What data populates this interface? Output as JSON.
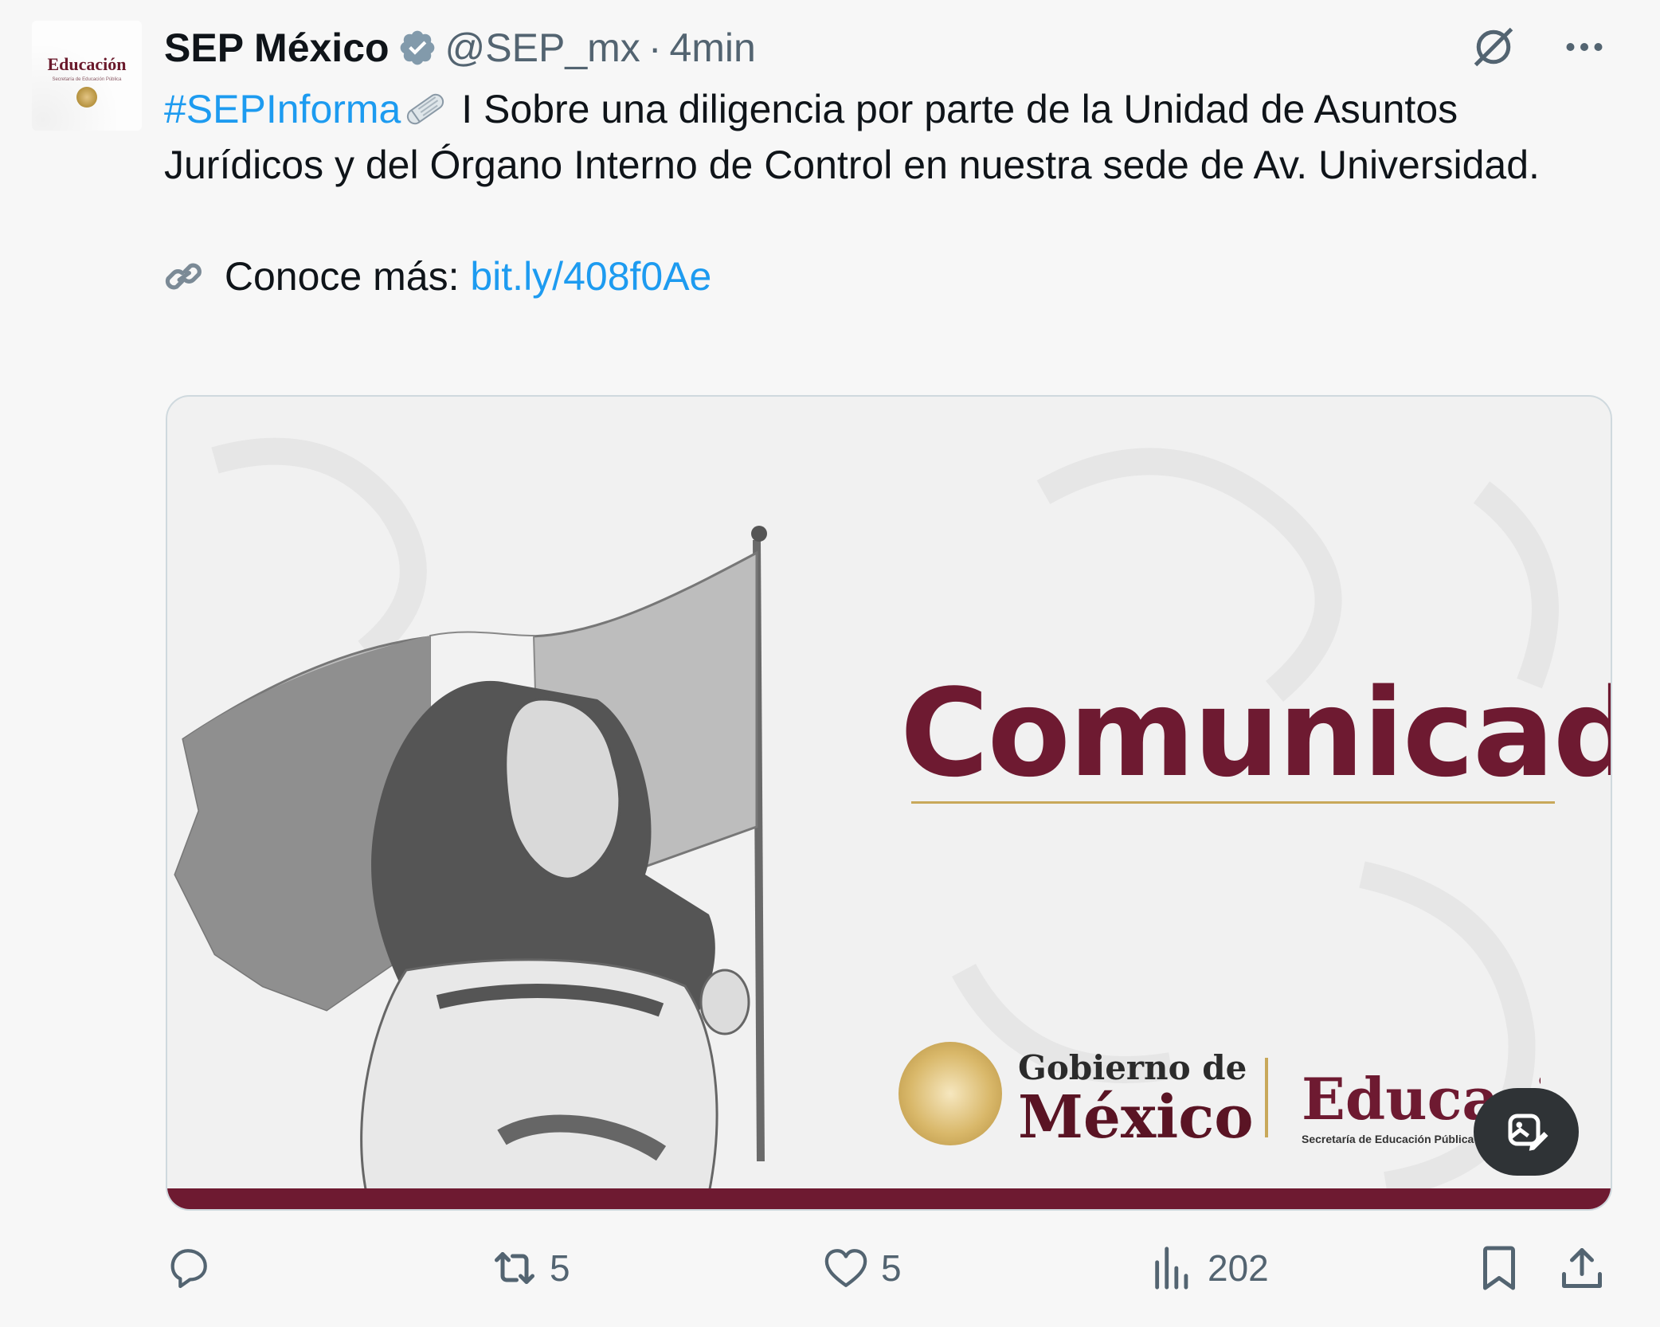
{
  "tweet": {
    "author": {
      "name": "SEP México",
      "handle": "@SEP_mx",
      "verified": true,
      "avatar_text": "Educación",
      "avatar_subtext": "Secretaría de Educación Pública"
    },
    "separator": "·",
    "time": "4min",
    "hashtag": "#SEPInforma",
    "text_after_hashtag": " I Sobre una diligencia por parte de la Unidad de Asuntos Jurídicos y del Órgano Interno de Control en nuestra sede de Av. Universidad.",
    "more_label": " Conoce más: ",
    "link": "bit.ly/408f0Ae",
    "emojis": [
      "newspaper-emoji",
      "link-emoji"
    ]
  },
  "media": {
    "headline": "Comunicado",
    "gobierno_line1": "Gobierno de",
    "gobierno_line2": "México",
    "edu_title": "Educación",
    "edu_subtitle": "Secretaría de Educación Pública",
    "colors": {
      "maroon": "#6e1a31",
      "gold": "#c8a85a"
    }
  },
  "metrics": {
    "replies": "",
    "reposts": "5",
    "likes": "5",
    "views": "202"
  },
  "colors": {
    "link": "#1d9bf0",
    "muted": "#536471",
    "text": "#0f1419",
    "background": "#f7f7f7"
  }
}
